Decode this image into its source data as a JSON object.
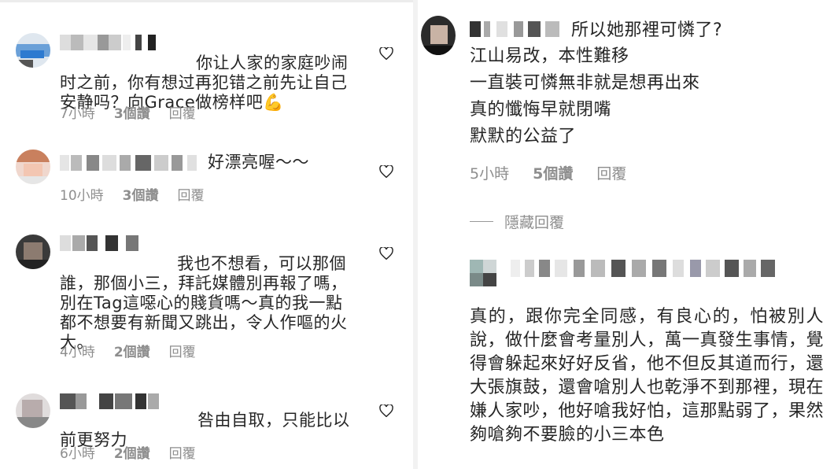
{
  "left": {
    "comments": [
      {
        "text_before_emoji": "你让人家的家庭吵闹时之前，你有想过再犯错之前先让自己安静吗？向Grace做榜样吧",
        "emoji": "💪",
        "time": "7小時",
        "likes": "3個讚",
        "reply": "回覆"
      },
      {
        "text": "好漂亮喔～～",
        "time": "10小時",
        "likes": "3個讚",
        "reply": "回覆"
      },
      {
        "text": "我也不想看，可以那個誰，那個小三，拜託媒體別再報了嗎，別在Tag這噁心的賤貨嗎～真的我一點都不想要有新聞又跳出，令人作嘔的火大。",
        "time": "4小時",
        "likes": "2個讚",
        "reply": "回覆"
      },
      {
        "text": "咎由自取，只能比以前更努力",
        "time": "6小時",
        "likes": "2個讚",
        "reply": "回覆"
      }
    ]
  },
  "right": {
    "comments": [
      {
        "lines": [
          "所以她那裡可憐了?",
          "江山易改，本性難移",
          "一直裝可憐無非就是想再出來",
          "真的懺悔早就閉嘴",
          "默默的公益了"
        ],
        "time": "5小時",
        "likes": "5個讚",
        "reply": "回覆"
      },
      {
        "text": "真的，跟你完全同感，有良心的，怕被別人說，做什麼會考量別人，萬一真發生事情，覺得會躲起來好好反省，他不但反其道而行，還大張旗鼓，還會嗆別人也乾淨不到那裡，現在嫌人家吵，他好嗆我好怕，這那點弱了，果然夠嗆夠不要臉的小三本色"
      }
    ],
    "hide_replies": "隱藏回覆"
  },
  "icons": {
    "like": "heart-outline-icon"
  },
  "colors": {
    "text": "#262626",
    "meta": "#8e8e8e"
  }
}
